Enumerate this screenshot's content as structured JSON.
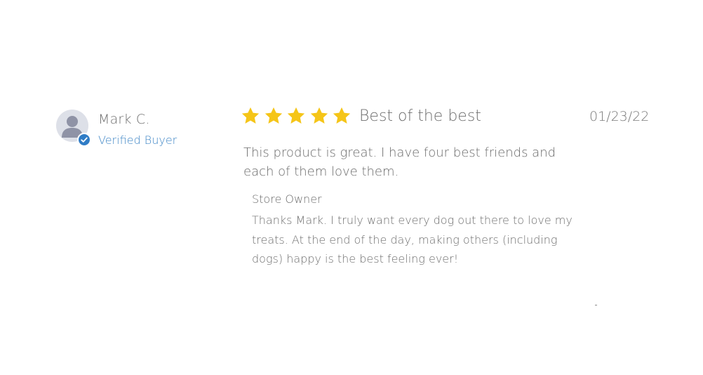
{
  "review": {
    "author": {
      "name": "Mark C.",
      "verified_label": "Verified Buyer",
      "avatar_icon": "user-silhouette-icon",
      "badge_icon": "checkmark-icon"
    },
    "rating": {
      "value": 5,
      "max": 5,
      "star_color": "#f5c518"
    },
    "title": "Best of the best",
    "date": "01/23/22",
    "body": "This product is great. I have four best friends and each of them love them.",
    "reply": {
      "author": "Store Owner",
      "text": "Thanks Mark. I truly want every dog out there to love my treats. At the end of the day, making others (including dogs) happy is the best feeling ever!"
    }
  },
  "colors": {
    "accent": "#3f86c6",
    "badge": "#2f7cc6",
    "text": "#6e6e6e",
    "background": "#ffffff"
  }
}
